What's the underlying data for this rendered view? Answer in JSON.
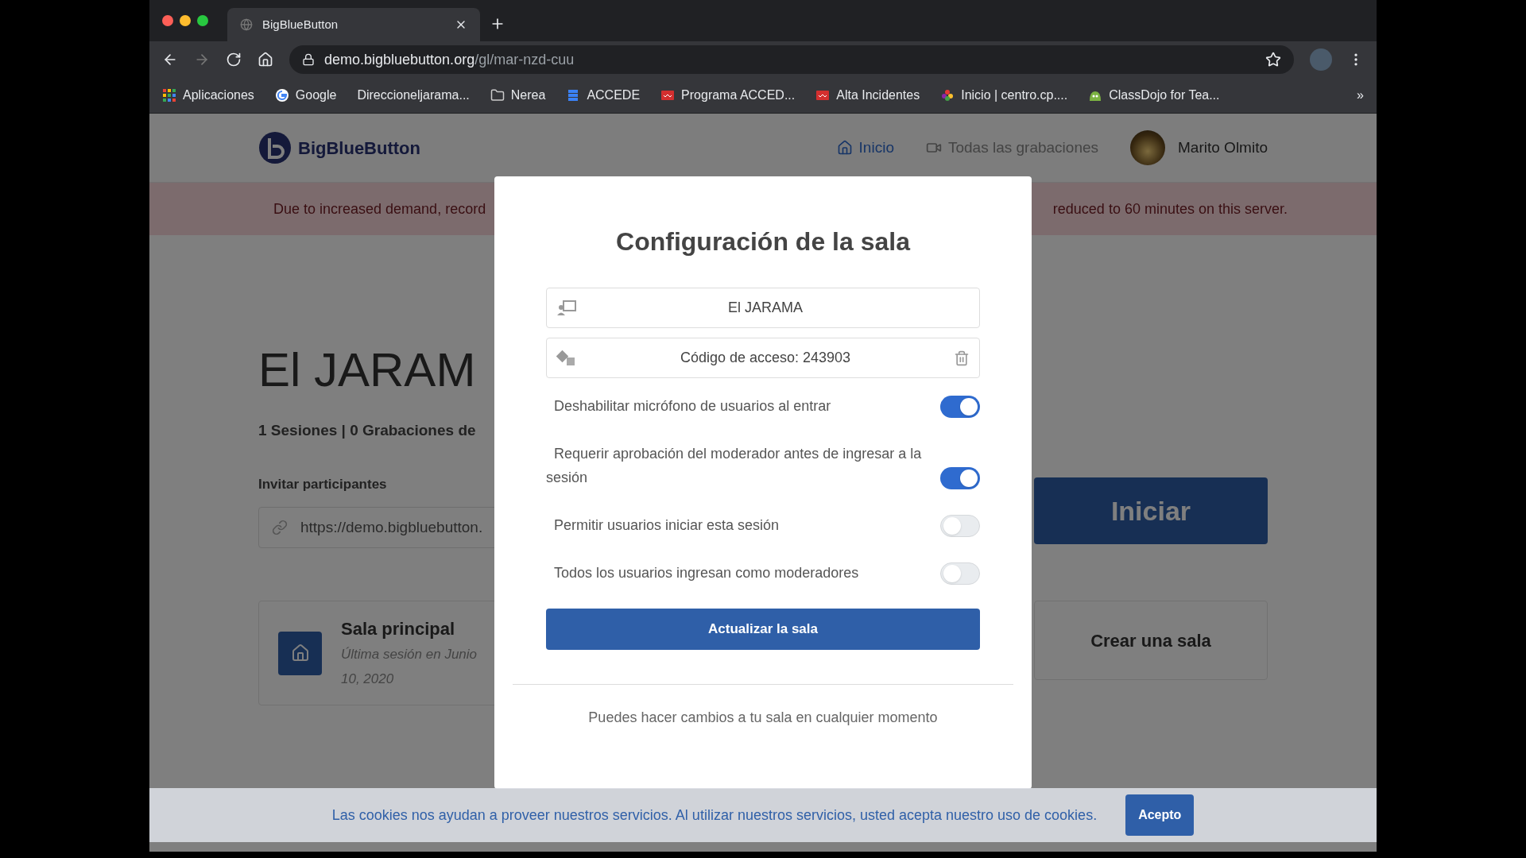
{
  "browser": {
    "tab_title": "BigBlueButton",
    "url_host": "demo.bigbluebutton.org",
    "url_path": "/gl/mar-nzd-cuu",
    "bookmarks": [
      "Aplicaciones",
      "Google",
      "Direccioneljarama...",
      "Nerea",
      "ACCEDE",
      "Programa ACCED...",
      "Alta Incidentes",
      "Inicio | centro.cp....",
      "ClassDojo for Tea..."
    ],
    "more": "»"
  },
  "header": {
    "logo": "BigBlueButton",
    "nav": [
      {
        "label": "Inicio",
        "selected": true
      },
      {
        "label": "Todas las grabaciones",
        "selected": false
      }
    ],
    "user": "Marito Olmito"
  },
  "banner": {
    "left": "Due to increased demand, record",
    "right": "reduced to 60 minutes on this server."
  },
  "room": {
    "title": "El JARAM",
    "stats": "1 Sesiones | 0 Grabaciones de",
    "invite_label": "Invitar participantes",
    "invite_url": "https://demo.bigbluebutton.",
    "start_button": "Iniciar",
    "rooms": [
      {
        "name": "Sala principal",
        "last_session": "Última sesión en Junio 10, 2020"
      }
    ],
    "create_room": "Crear una sala"
  },
  "modal": {
    "title": "Configuración de la sala",
    "fields": [
      {
        "kind": "name",
        "value": "El JARAMA"
      },
      {
        "kind": "access_code",
        "value": "Código de acceso: 243903"
      }
    ],
    "toggles": [
      {
        "label": "Deshabilitar micrófono de usuarios al entrar",
        "on": true
      },
      {
        "label": "Requerir aprobación del moderador antes de ingresar a la sesión",
        "on": true
      },
      {
        "label": "Permitir usuarios iniciar esta sesión",
        "on": false
      },
      {
        "label": "Todos los usuarios ingresan como moderadores",
        "on": false
      }
    ],
    "submit": "Actualizar la sala",
    "footnote": "Puedes hacer cambios a tu sala en cualquier momento"
  },
  "cookies": {
    "text": "Las cookies nos ayudan a proveer nuestros servicios. Al utilizar nuestros servicios, usted acepta nuestro uso de cookies.",
    "accept": "Acepto"
  }
}
